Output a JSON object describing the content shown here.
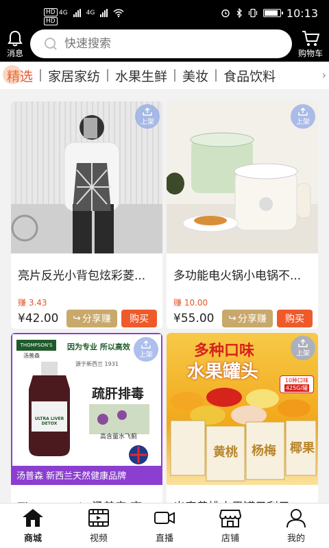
{
  "status_bar": {
    "left_tags": [
      "HD",
      "HD"
    ],
    "network_left": "4G",
    "network_right": "4G",
    "time": "10:13"
  },
  "header": {
    "message_label": "消息",
    "search_placeholder": "快速搜索",
    "cart_label": "购物车"
  },
  "categories": [
    "精选",
    "家居家纺",
    "水果生鲜",
    "美妆",
    "食品饮料"
  ],
  "products": [
    {
      "title": "亮片反光小背包炫彩菱...",
      "earn": "赚 3.43",
      "price": "¥42.00",
      "badge": "上架"
    },
    {
      "title": "多功能电火锅小电锅不...",
      "earn": "赚 10.00",
      "price": "¥55.00",
      "badge": "上架"
    },
    {
      "title": "Thompson's 汤普森 高...",
      "badge": "上架",
      "image_text": {
        "brand": "THOMPSON'S",
        "brand_cn": "汤普森",
        "slogan": "因为专业 所以高效",
        "since": "源于新西兰 1931",
        "product_name": "ULTRA LIVER DETOX",
        "headline": "疏肝排毒",
        "sub": "高含量水飞蓟",
        "banner": "汤普森 新西兰天然健康品牌"
      }
    },
    {
      "title": "出奇黄桃水果罐子利子...",
      "badge": "上架",
      "image_text": {
        "headline1": "多种口味",
        "headline2": "水果罐头",
        "tag": "10种口味",
        "weight": "425G/罐",
        "can1": "黄桃",
        "can2": "杨梅",
        "can3": "椰果"
      }
    }
  ],
  "buttons": {
    "share": "分享赚",
    "buy": "购买"
  },
  "tabbar": [
    "商城",
    "视频",
    "直播",
    "店铺",
    "我的"
  ]
}
